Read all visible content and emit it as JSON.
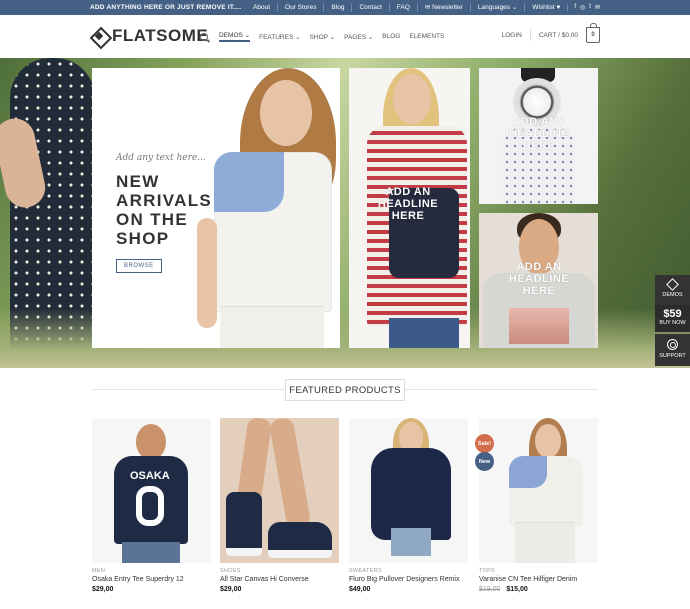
{
  "topbar": {
    "promo": "ADD ANYTHING HERE OR JUST REMOVE IT....",
    "links": [
      "About",
      "Our Stores",
      "Blog",
      "Contact",
      "FAQ",
      "✉ Newsletter",
      "Languages ⌄",
      "Wishlist ♥"
    ],
    "social": [
      "f",
      "◎",
      "t",
      "✉"
    ]
  },
  "header": {
    "logo": "FLATSOME",
    "nav": [
      "DEMOS ⌄",
      "FEATURES ⌄",
      "SHOP ⌄",
      "PAGES ⌄",
      "BLOG",
      "ELEMENTS"
    ],
    "login": "LOGIN",
    "cart": "CART / $0.00",
    "cart_count": "0"
  },
  "hero": {
    "small_text": "Add any text here...",
    "headline": "NEW ARRIVALS ON THE SHOP",
    "button": "BROWSE",
    "panel2_headline": "ADD AN HEADLINE HERE",
    "panel3_headline": "ADD ANY HEADLINE HERE",
    "panel4_headline": "ADD AN HEADLINE HERE"
  },
  "side": {
    "demos": "DEMOS",
    "price": "$59",
    "buy": "BUY NOW",
    "support": "SUPPORT"
  },
  "featured": {
    "title": "FEATURED PRODUCTS",
    "products": [
      {
        "category": "MEN",
        "name": "Osaka Entry Tee Superdry 12",
        "price": "$29,00",
        "old_price": ""
      },
      {
        "category": "SHOES",
        "name": "All Star Canvas Hi Converse",
        "price": "$29,00",
        "old_price": ""
      },
      {
        "category": "SWEATERS",
        "name": "Fluro Big Pullover Designers Remix",
        "price": "$49,00",
        "old_price": ""
      },
      {
        "category": "TOPS",
        "name": "Varanise CN Tee Hilfiger Denim",
        "price": "$15,00",
        "old_price": "$19,00"
      }
    ],
    "badges": {
      "sale": "Sale!",
      "new": "New"
    },
    "shirt_text": "OSAKA"
  },
  "colors": {
    "primary": "#446084",
    "sale_badge": "#d26e4b",
    "new_badge": "#446084"
  }
}
